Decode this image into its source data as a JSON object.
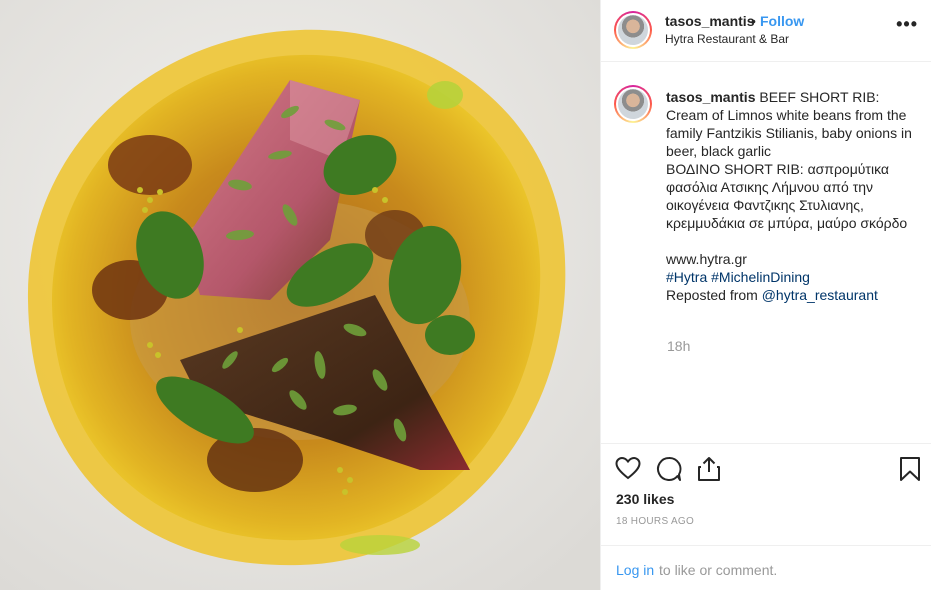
{
  "header": {
    "username": "tasos_mantis",
    "separator": "•",
    "follow_label": "Follow",
    "location": "Hytra Restaurant & Bar",
    "more_label": "•••"
  },
  "caption": {
    "username": "tasos_mantis",
    "text_en": "BEEF SHORT RIB: Cream of Limnos white beans from the family Fantzikis Stilianis, baby onions in beer, black garlic",
    "text_gr": "ΒΟΔΙΝΟ SHORT RIB: ασπρομύτικα φασόλια Ατσικης Λήμνου από την οικογένεια Φαντζικης Στυλιανης, κρεμμυδάκια σε μπύρα, μαύρο σκόρδο",
    "website": "www.hytra.gr",
    "hashtags": "#Hytra #MichelinDining",
    "reposted_prefix": "Reposted from ",
    "reposted_handle": "@hytra_restaurant",
    "time": "18h"
  },
  "actions": {
    "icons": [
      "heart-icon",
      "comment-icon",
      "share-icon",
      "bookmark-icon"
    ],
    "likes": "230 likes",
    "time_ago": "18 HOURS AGO"
  },
  "comment_bar": {
    "login_label": "Log in",
    "rest_label": "to like or comment."
  },
  "colors": {
    "link_blue": "#3897f0",
    "hashtag_navy": "#003569",
    "muted_gray": "#999999"
  }
}
